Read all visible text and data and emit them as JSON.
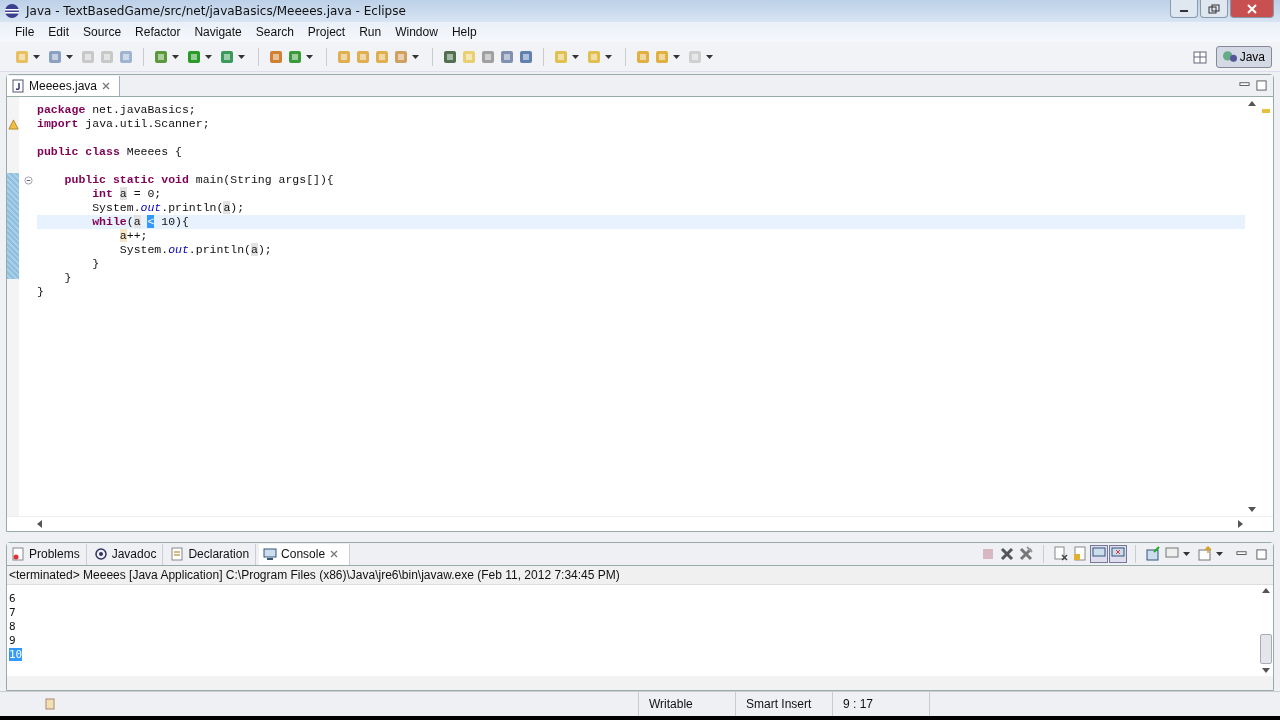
{
  "window": {
    "title": "Java - TextBasedGame/src/net/javaBasics/Meeees.java - Eclipse"
  },
  "menu": [
    "File",
    "Edit",
    "Source",
    "Refactor",
    "Navigate",
    "Search",
    "Project",
    "Run",
    "Window",
    "Help"
  ],
  "perspective": {
    "label": "Java",
    "selected": true
  },
  "editor": {
    "tabs": [
      {
        "label": "Meeees.java",
        "selected": true
      }
    ],
    "lines": [
      {
        "kind": "code",
        "tokens": [
          {
            "text": "package",
            "kind": "keyword"
          },
          {
            "text": " net.javaBasics;",
            "kind": "plain"
          }
        ]
      },
      {
        "kind": "code",
        "warning": true,
        "tokens": [
          {
            "text": "import",
            "kind": "keyword"
          },
          {
            "text": " java.util.Scanner;",
            "kind": "plain"
          }
        ]
      },
      {
        "kind": "blank"
      },
      {
        "kind": "code",
        "tokens": [
          {
            "text": "public class",
            "kind": "keyword"
          },
          {
            "text": " Meeees {",
            "kind": "plain"
          }
        ]
      },
      {
        "kind": "blank"
      },
      {
        "kind": "code",
        "fold": true,
        "tokens": [
          {
            "text": "    public static void",
            "kind": "keyword"
          },
          {
            "text": " main(String args[]){",
            "kind": "plain"
          }
        ]
      },
      {
        "kind": "code",
        "tokens": [
          {
            "text": "        int",
            "kind": "keyword"
          },
          {
            "text": " a",
            "kind": "occurrence"
          },
          {
            "text": " = 0;",
            "kind": "plain"
          }
        ]
      },
      {
        "kind": "code",
        "tokens": [
          {
            "text": "        System.",
            "kind": "plain"
          },
          {
            "text": "out",
            "kind": "field"
          },
          {
            "text": ".println(",
            "kind": "plain"
          },
          {
            "text": "a",
            "kind": "occurrence"
          },
          {
            "text": ");",
            "kind": "plain"
          }
        ]
      },
      {
        "kind": "code",
        "current": true,
        "tokens": [
          {
            "text": "        while",
            "kind": "keyword"
          },
          {
            "text": "(",
            "kind": "plain"
          },
          {
            "text": "a",
            "kind": "occurrence"
          },
          {
            "text": " <",
            "kind": "selection"
          },
          {
            "text": " 10){",
            "kind": "plain"
          }
        ]
      },
      {
        "kind": "code",
        "tokens": [
          {
            "text": "            a",
            "kind": "occurrence"
          },
          {
            "text": "++;",
            "kind": "plain"
          }
        ]
      },
      {
        "kind": "code",
        "tokens": [
          {
            "text": "            System.",
            "kind": "plain"
          },
          {
            "text": "out",
            "kind": "field"
          },
          {
            "text": ".println(",
            "kind": "plain"
          },
          {
            "text": "a",
            "kind": "occurrence"
          },
          {
            "text": ");",
            "kind": "plain"
          }
        ]
      },
      {
        "kind": "code",
        "tokens": [
          {
            "text": "        }",
            "kind": "plain"
          }
        ]
      },
      {
        "kind": "code",
        "tokens": [
          {
            "text": "    }",
            "kind": "plain"
          }
        ]
      },
      {
        "kind": "code",
        "tokens": [
          {
            "text": "}",
            "kind": "plain"
          }
        ]
      }
    ]
  },
  "bottom_panel": {
    "tabs": [
      {
        "label": "Problems",
        "selected": false
      },
      {
        "label": "Javadoc",
        "selected": false
      },
      {
        "label": "Declaration",
        "selected": false
      },
      {
        "label": "Console",
        "selected": true
      }
    ],
    "console_header": "<terminated> Meeees [Java Application] C:\\Program Files (x86)\\Java\\jre6\\bin\\javaw.exe (Feb 11, 2012 7:34:45 PM)",
    "output": [
      {
        "text": "6",
        "selected": false
      },
      {
        "text": "7",
        "selected": false
      },
      {
        "text": "8",
        "selected": false
      },
      {
        "text": "9",
        "selected": false
      },
      {
        "text": "10",
        "selected": true
      }
    ]
  },
  "status_bar": [
    "Writable",
    "Smart Insert",
    "9 : 17"
  ]
}
